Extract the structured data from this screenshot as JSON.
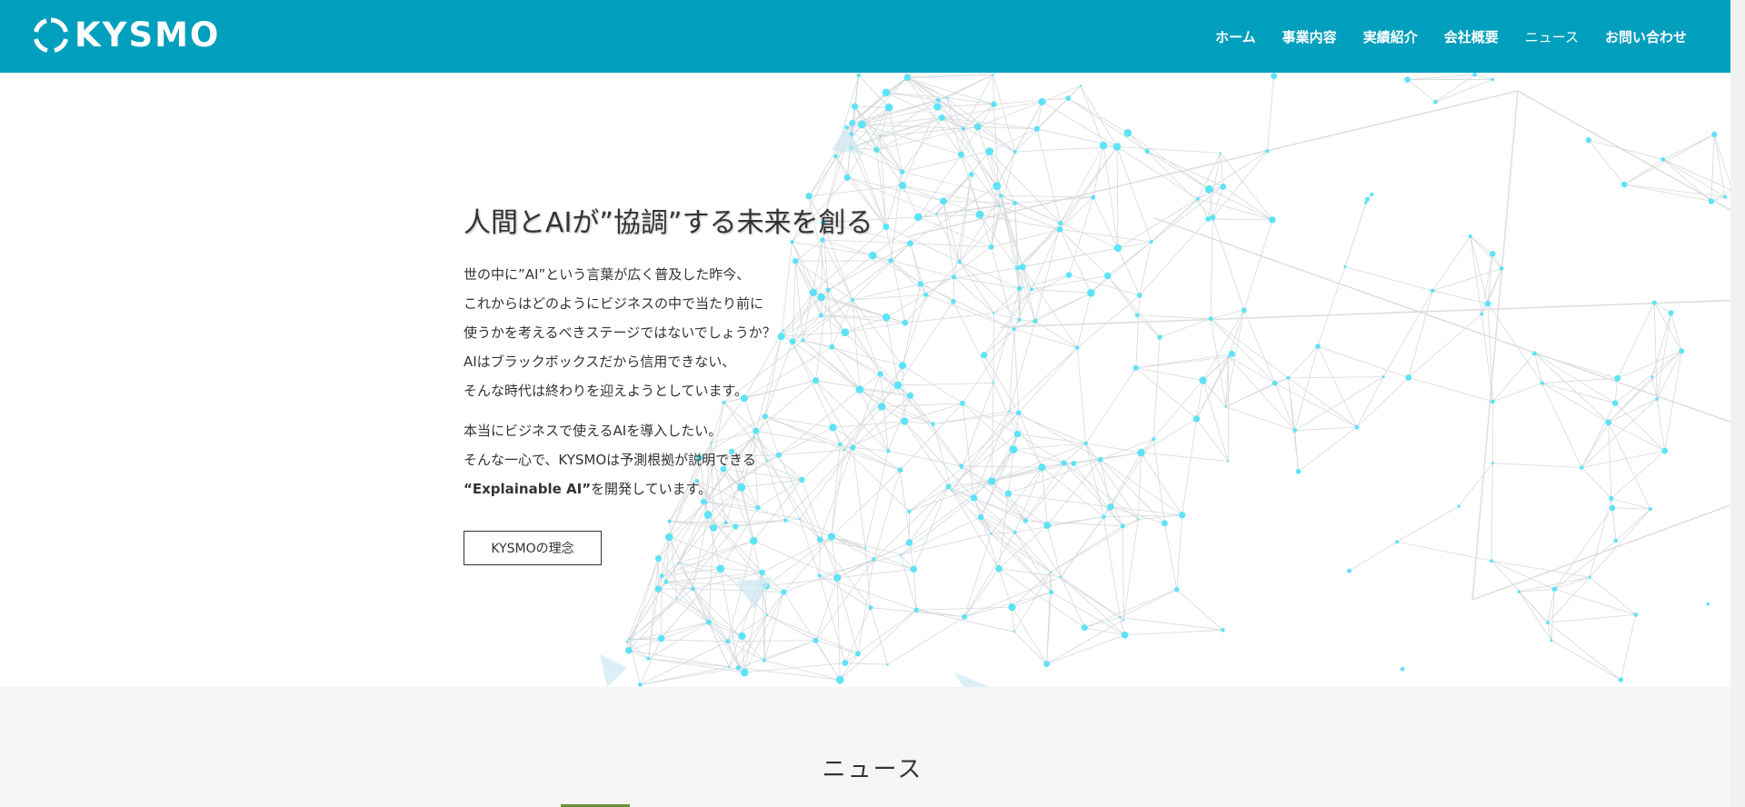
{
  "header": {
    "logo_text": "KYSMO",
    "nav": [
      {
        "label": "ホーム"
      },
      {
        "label": "事業内容"
      },
      {
        "label": "実績紹介"
      },
      {
        "label": "会社概要"
      },
      {
        "label": "ニュース"
      },
      {
        "label": "お問い合わせ"
      }
    ]
  },
  "hero": {
    "title": "人間とAIが”協調”する未来を創る",
    "para1": [
      "世の中に”AI”という言葉が広く普及した昨今、",
      "これからはどのようにビジネスの中で当たり前に",
      "使うかを考えるべきステージではないでしょうか？",
      "AIはブラックボックスだから信用できない、",
      "そんな時代は終わりを迎えようとしています。"
    ],
    "para2": [
      "本当にビジネスで使えるAIを導入したい。",
      "そんな一心で、KYSMOは予測根拠が説明できる"
    ],
    "para2_bold": "“Explainable AI”",
    "para2_tail": "を開発しています。",
    "cta_label": "KYSMOの理念"
  },
  "news": {
    "title": "ニュース"
  },
  "colors": {
    "brand": "#009fbd",
    "dot": "#5ee3f6",
    "accent_green": "#6b8e3a"
  }
}
